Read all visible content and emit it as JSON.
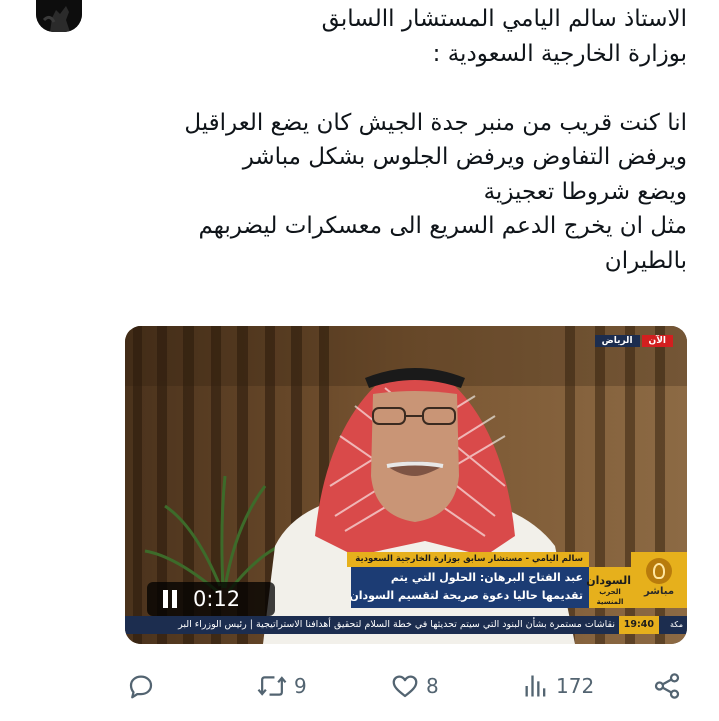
{
  "tweet": {
    "lines": [
      "الاستاذ سالم اليامي المستشار االسابق",
      "بوزارة الخارجية السعودية :",
      "",
      "انا كنت قريب من منبر جدة الجيش كان يضع العراقيل",
      "ويرفض التفاوض ويرفض الجلوس بشكل مباشر",
      "ويضع شروطا تعجيزية",
      "مثل ان يخرج الدعم السريع الى معسكرات ليضربهم",
      "بالطيران"
    ]
  },
  "video": {
    "live_label": "الآن",
    "city_label": "الرياض",
    "name_strip": "سالم اليامي - مستشار سابق بوزارة الخارجية السعودية",
    "headline_line1": "عبد الفتاح البرهان: الحلول التي يتم",
    "headline_line2": "تقديمها حاليا دعوة صريحة لتقسيم السودان",
    "section_title": "السودان",
    "section_sub": "الحرب المنسية",
    "channel_live": "مباشر",
    "ticker_time": "19:40",
    "ticker_city": "مكة",
    "ticker_text": "نقاشات مستمرة بشأن البنود التي سيتم تحديثها في خطة السلام لتحقيق أهدافنا الاستراتيجية | رئيس الوزراء البر",
    "timer": "0:12",
    "colors": {
      "accent": "#e6b01c",
      "navy": "#1c3c74",
      "live_red": "#d21f1f"
    }
  },
  "actions": {
    "reply_icon": "reply-icon",
    "retweet_count": "9",
    "like_count": "8",
    "views_count": "172",
    "share_icon": "share-icon"
  }
}
